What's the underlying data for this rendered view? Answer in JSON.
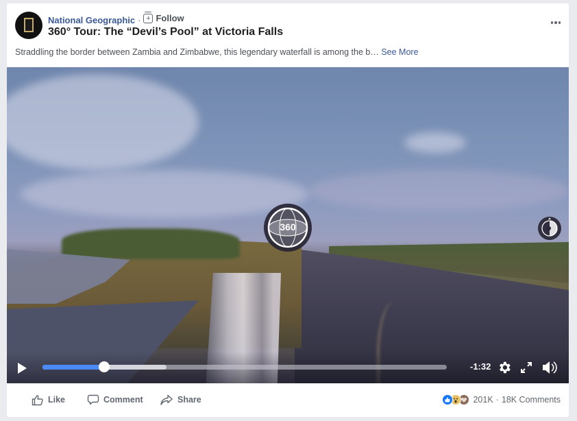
{
  "post": {
    "page_name": "National Geographic",
    "separator": "·",
    "follow_label": "Follow",
    "title": "360° Tour: The “Devil’s Pool” at Victoria Falls",
    "description": "Straddling the border between Zambia and Zimbabwe, this legendary waterfall is among the b…",
    "see_more_label": "See More",
    "more_icon": "more-horizontal-icon"
  },
  "video": {
    "badge_label": "360",
    "time_remaining": "-1:32",
    "progress_fraction": 0.153,
    "buffered_fraction": 0.307,
    "icons": [
      "play-icon",
      "settings-gear-icon",
      "fullscreen-icon",
      "volume-icon",
      "compass-icon",
      "360-globe-icon"
    ]
  },
  "footer": {
    "actions": [
      {
        "label": "Like",
        "icon": "thumbs-up-icon"
      },
      {
        "label": "Comment",
        "icon": "comment-bubble-icon"
      },
      {
        "label": "Share",
        "icon": "share-arrow-icon"
      }
    ],
    "reaction_count": "201K",
    "comment_count": "18K Comments",
    "stats_separator": "·",
    "reactions": [
      "like",
      "wow",
      "love"
    ],
    "colors": {
      "like": "#1877f2",
      "wow": "#e8c266",
      "love_muted": "#8a6b5a",
      "link": "#385898",
      "progress": "#4a8af4"
    }
  }
}
